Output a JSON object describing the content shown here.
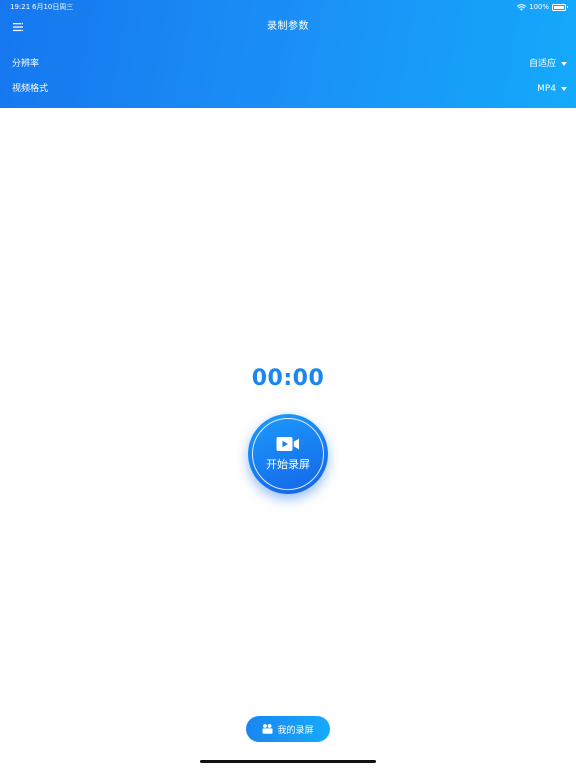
{
  "status_bar": {
    "time": "19:21",
    "date": "6月10日周三",
    "battery": "100%",
    "wifi_icon": "wifi-icon",
    "battery_icon": "battery-icon"
  },
  "header": {
    "title": "录制参数",
    "menu_icon": "menu-icon",
    "gradient_colors": [
      "#1577ef",
      "#14a9fb"
    ]
  },
  "params": [
    {
      "label": "分辨率",
      "value": "自适应",
      "icon": "caret-down-icon"
    },
    {
      "label": "视频格式",
      "value": "MP4",
      "icon": "caret-down-icon"
    }
  ],
  "timer": "00:00",
  "record_button": {
    "label": "开始录屏",
    "icon": "video-camera-icon",
    "accent_color": "#1a86f0"
  },
  "my_recordings": {
    "label": "我的录屏",
    "icon": "film-reel-icon"
  }
}
